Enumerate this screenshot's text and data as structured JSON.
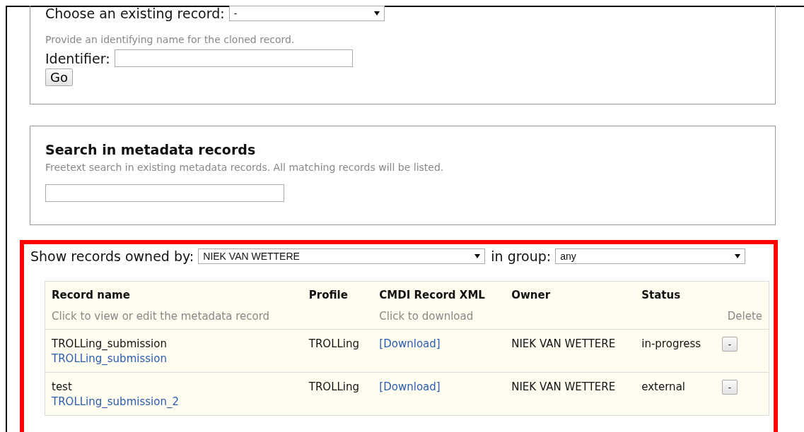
{
  "clone": {
    "choose_label": "Choose an existing record:",
    "choose_value": "-",
    "hint": "Provide an identifying name for the cloned record.",
    "identifier_label": "Identifier:",
    "go_button": "Go"
  },
  "search": {
    "title": "Search in metadata records",
    "hint": "Freetext search in existing metadata records. All matching records will be listed."
  },
  "filter": {
    "owner_label": "Show records owned by:",
    "owner_value": "NIEK VAN WETTERE",
    "group_label": "in group:",
    "group_value": "any"
  },
  "table": {
    "columns": [
      {
        "title": "Record name",
        "hint": "Click to view or edit the metadata record"
      },
      {
        "title": "Profile"
      },
      {
        "title": "CMDI Record XML",
        "hint": "Click to download"
      },
      {
        "title": "Owner"
      },
      {
        "title": "Status"
      },
      {
        "hint": "Delete"
      }
    ],
    "rows": [
      {
        "name": "TROLLing_submission",
        "link": "TROLLing_submission",
        "profile": "TROLLing",
        "download": "[Download]",
        "owner": "NIEK VAN WETTERE",
        "status": "in-progress",
        "delete": "-"
      },
      {
        "name": "test",
        "link": "TROLLing_submission_2",
        "profile": "TROLLing",
        "download": "[Download]",
        "owner": "NIEK VAN WETTERE",
        "status": "external",
        "delete": "-"
      }
    ]
  }
}
